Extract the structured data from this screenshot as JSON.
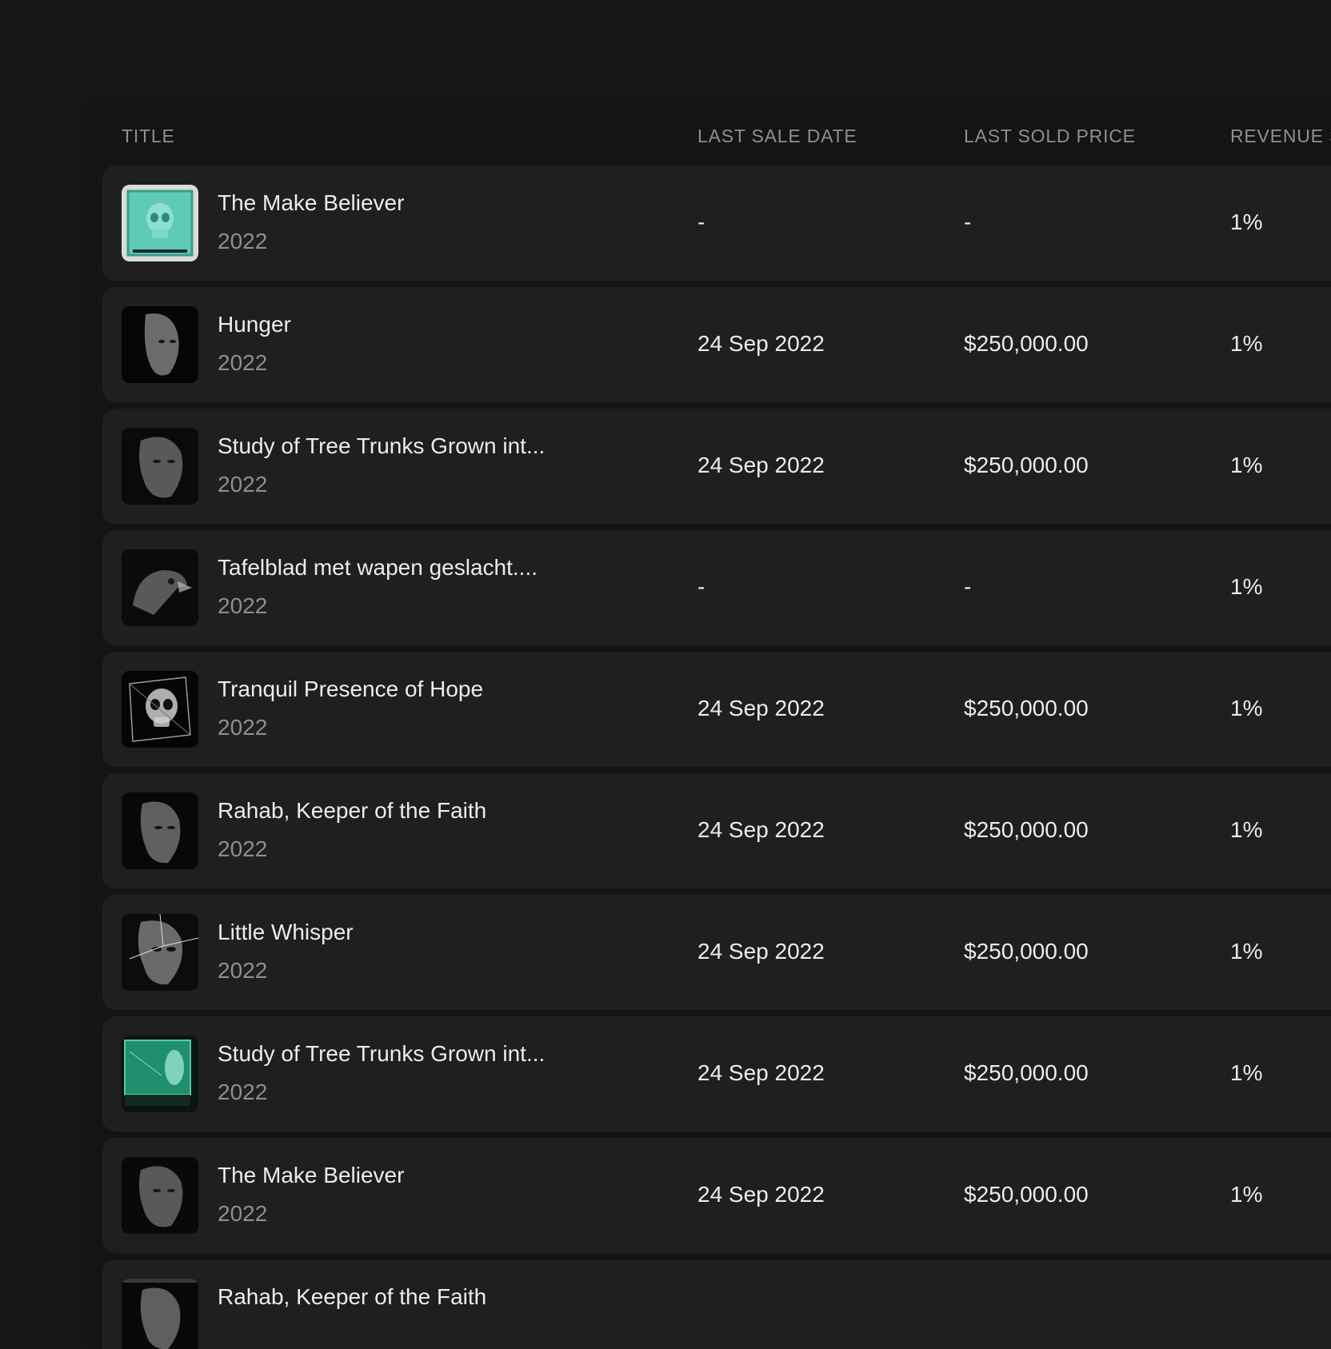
{
  "table": {
    "columns": [
      "TITLE",
      "LAST SALE DATE",
      "LAST SOLD PRICE",
      "REVENUE S"
    ],
    "rows": [
      {
        "title": "The Make Believer",
        "year": "2022",
        "last_sale_date": "-",
        "last_sold_price": "-",
        "revenue": "1%",
        "thumb": "teal-skull-cube"
      },
      {
        "title": "Hunger",
        "year": "2022",
        "last_sale_date": "24 Sep 2022",
        "last_sold_price": "$250,000.00",
        "revenue": "1%",
        "thumb": "dark-face"
      },
      {
        "title": "Study of Tree Trunks Grown int...",
        "year": "2022",
        "last_sale_date": "24 Sep 2022",
        "last_sold_price": "$250,000.00",
        "revenue": "1%",
        "thumb": "dark-face"
      },
      {
        "title": "Tafelblad met wapen geslacht....",
        "year": "2022",
        "last_sale_date": "-",
        "last_sold_price": "-",
        "revenue": "1%",
        "thumb": "eagle"
      },
      {
        "title": "Tranquil Presence of Hope",
        "year": "2022",
        "last_sale_date": "24 Sep 2022",
        "last_sold_price": "$250,000.00",
        "revenue": "1%",
        "thumb": "glass-skull"
      },
      {
        "title": "Rahab, Keeper of the Faith",
        "year": "2022",
        "last_sale_date": "24 Sep 2022",
        "last_sold_price": "$250,000.00",
        "revenue": "1%",
        "thumb": "dark-face"
      },
      {
        "title": "Little Whisper",
        "year": "2022",
        "last_sale_date": "24 Sep 2022",
        "last_sold_price": "$250,000.00",
        "revenue": "1%",
        "thumb": "cracked-face"
      },
      {
        "title": "Study of Tree Trunks Grown int...",
        "year": "2022",
        "last_sale_date": "24 Sep 2022",
        "last_sold_price": "$250,000.00",
        "revenue": "1%",
        "thumb": "green-cube"
      },
      {
        "title": "The Make Believer",
        "year": "2022",
        "last_sale_date": "24 Sep 2022",
        "last_sold_price": "$250,000.00",
        "revenue": "1%",
        "thumb": "dark-face"
      },
      {
        "title": "Rahab, Keeper of the Faith",
        "year": "",
        "last_sale_date": "",
        "last_sold_price": "",
        "revenue": "",
        "thumb": "dark-face"
      }
    ]
  },
  "colors": {
    "background": "#161617",
    "panel": "#141414",
    "row": "#1f1f20",
    "text": "#ececec",
    "muted": "#8e8e92",
    "teal": "#4fc2b0"
  }
}
